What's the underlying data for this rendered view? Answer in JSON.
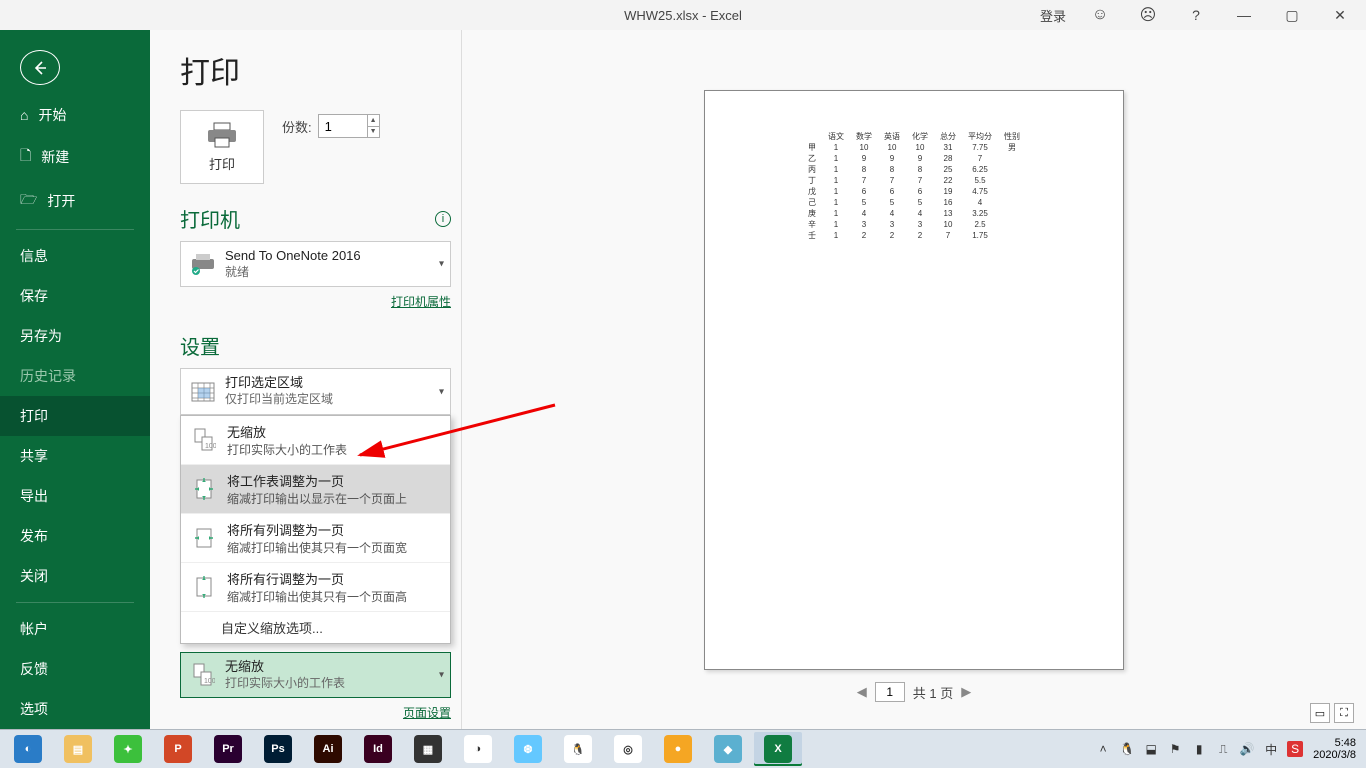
{
  "titlebar": {
    "filename": "WHW25.xlsx  -  Excel",
    "login": "登录"
  },
  "sidebar": {
    "home": "开始",
    "new": "新建",
    "open": "打开",
    "info": "信息",
    "save": "保存",
    "saveas": "另存为",
    "history": "历史记录",
    "print": "打印",
    "share": "共享",
    "export": "导出",
    "publish": "发布",
    "close": "关闭",
    "account": "帐户",
    "feedback": "反馈",
    "options": "选项"
  },
  "print": {
    "title": "打印",
    "button_label": "打印",
    "copies_label": "份数:",
    "copies_value": "1",
    "printer_section": "打印机",
    "printer_name": "Send To OneNote 2016",
    "printer_status": "就绪",
    "printer_props_link": "打印机属性",
    "settings_section": "设置",
    "area": {
      "title": "打印选定区域",
      "sub": "仅打印当前选定区域"
    },
    "scale_opts": [
      {
        "title": "无缩放",
        "sub": "打印实际大小的工作表"
      },
      {
        "title": "将工作表调整为一页",
        "sub": "缩减打印输出以显示在一个页面上"
      },
      {
        "title": "将所有列调整为一页",
        "sub": "缩减打印输出使其只有一个页面宽"
      },
      {
        "title": "将所有行调整为一页",
        "sub": "缩减打印输出使其只有一个页面高"
      }
    ],
    "custom_scale": "自定义缩放选项...",
    "current_scale": {
      "title": "无缩放",
      "sub": "打印实际大小的工作表"
    },
    "page_setup_link": "页面设置",
    "pager": {
      "of_label": "共 1 页",
      "page": "1"
    }
  },
  "chart_data": {
    "type": "table",
    "headers": [
      "",
      "语文",
      "数学",
      "英语",
      "化学",
      "总分",
      "平均分",
      "性别"
    ],
    "rows": [
      [
        "甲",
        "1",
        "10",
        "10",
        "10",
        "31",
        "7.75",
        "男"
      ],
      [
        "乙",
        "1",
        "9",
        "9",
        "9",
        "28",
        "7",
        ""
      ],
      [
        "丙",
        "1",
        "8",
        "8",
        "8",
        "25",
        "6.25",
        ""
      ],
      [
        "丁",
        "1",
        "7",
        "7",
        "7",
        "22",
        "5.5",
        ""
      ],
      [
        "戊",
        "1",
        "6",
        "6",
        "6",
        "19",
        "4.75",
        ""
      ],
      [
        "己",
        "1",
        "5",
        "5",
        "5",
        "16",
        "4",
        ""
      ],
      [
        "庚",
        "1",
        "4",
        "4",
        "4",
        "13",
        "3.25",
        ""
      ],
      [
        "辛",
        "1",
        "3",
        "3",
        "3",
        "10",
        "2.5",
        ""
      ],
      [
        "壬",
        "1",
        "2",
        "2",
        "2",
        "7",
        "1.75",
        ""
      ]
    ]
  },
  "taskbar": {
    "time": "5:48",
    "date": "2020/3/8",
    "apps": [
      {
        "name": "browser-qq",
        "bg": "#2a7cc7",
        "label": "◐"
      },
      {
        "name": "explorer",
        "bg": "#f0c060",
        "label": "▤"
      },
      {
        "name": "wechat",
        "bg": "#3cc03c",
        "label": "✦"
      },
      {
        "name": "powerpoint",
        "bg": "#d24726",
        "label": "P"
      },
      {
        "name": "premiere",
        "bg": "#2a0030",
        "label": "Pr"
      },
      {
        "name": "photoshop",
        "bg": "#001d34",
        "label": "Ps"
      },
      {
        "name": "illustrator",
        "bg": "#2e0a00",
        "label": "Ai"
      },
      {
        "name": "indesign",
        "bg": "#3a0020",
        "label": "Id"
      },
      {
        "name": "video-editor",
        "bg": "#333",
        "label": "▦"
      },
      {
        "name": "app-a",
        "bg": "#fff",
        "label": "◑"
      },
      {
        "name": "app-b",
        "bg": "#64c8ff",
        "label": "❆"
      },
      {
        "name": "qq",
        "bg": "#fff",
        "label": "🐧"
      },
      {
        "name": "chrome",
        "bg": "#fff",
        "label": "◎"
      },
      {
        "name": "app-c",
        "bg": "#f5a623",
        "label": "●"
      },
      {
        "name": "notes",
        "bg": "#5bb0d0",
        "label": "◆"
      },
      {
        "name": "excel",
        "bg": "#107c41",
        "label": "X"
      }
    ]
  }
}
